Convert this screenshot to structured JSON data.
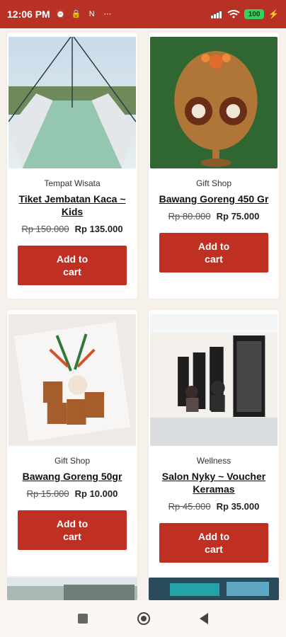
{
  "status_bar": {
    "time": "12:06 PM",
    "icons": [
      "alarm-icon",
      "lock-icon",
      "notification-n-icon",
      "more-dots-icon",
      "signal-icon",
      "wifi-icon",
      "battery-icon",
      "charging-icon"
    ],
    "battery": "100"
  },
  "products": [
    {
      "category": "Tempat Wisata",
      "title": "Tiket Jembatan Kaca ~ Kids",
      "old_price": "Rp 150.000",
      "price": "Rp 135.000",
      "button_line1": "Add to",
      "button_line2": "cart"
    },
    {
      "category": "Gift Shop",
      "title": "Bawang Goreng 450 Gr",
      "old_price": "Rp 80.000",
      "price": "Rp 75.000",
      "button_line1": "Add to",
      "button_line2": "cart"
    },
    {
      "category": "Gift Shop",
      "title": "Bawang Goreng 50gr",
      "old_price": "Rp 15.000",
      "price": "Rp 10.000",
      "button_line1": "Add to",
      "button_line2": "cart"
    },
    {
      "category": "Wellness",
      "title": "Salon Nyky ~ Voucher Keramas",
      "old_price": "Rp 45.000",
      "price": "Rp 35.000",
      "button_line1": "Add to",
      "button_line2": "cart"
    }
  ],
  "nav": {
    "recent": "recent-apps-icon",
    "home": "home-icon",
    "back": "back-icon"
  },
  "colors": {
    "brand": "#b73224",
    "button": "#bf3022",
    "battery": "#34d15c"
  }
}
